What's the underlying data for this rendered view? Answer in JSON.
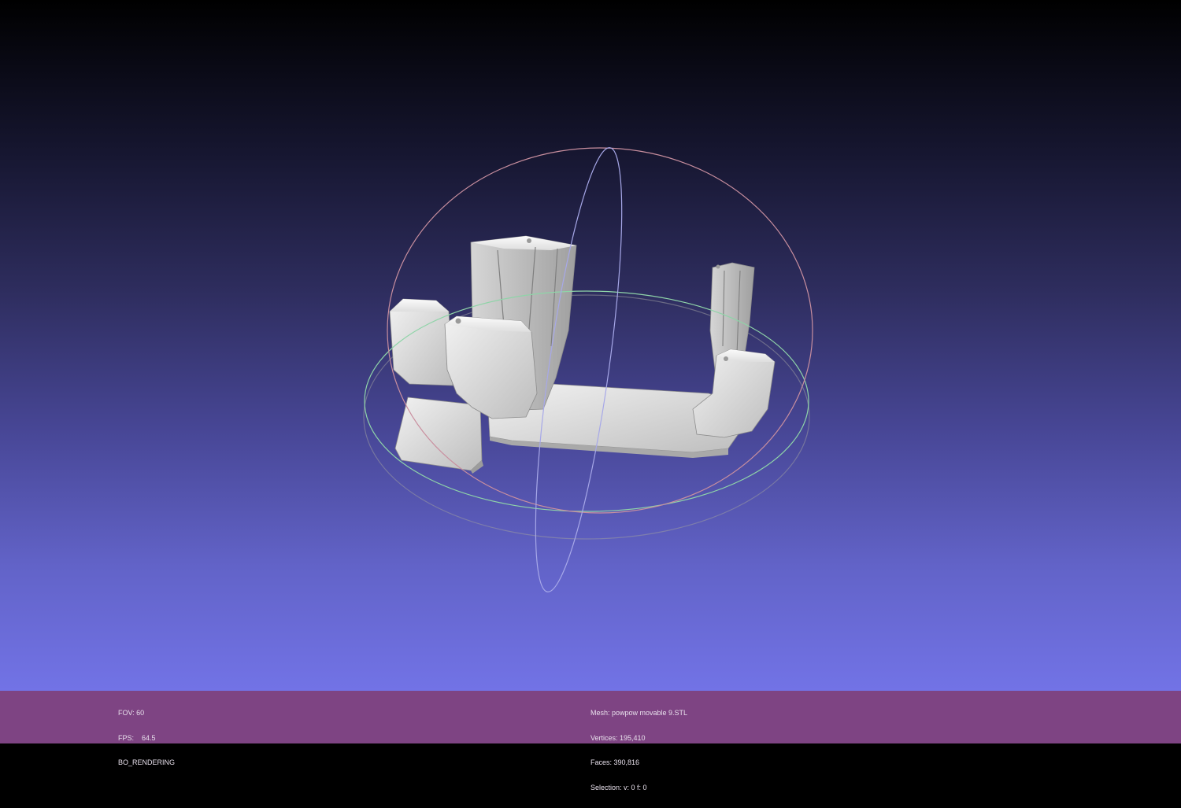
{
  "window": {
    "background_top": "#000000",
    "background_bottom": "#7273e6",
    "status_bar_color": "#7e4483"
  },
  "viewport": {
    "object": "3d-mesh-model",
    "trackball": {
      "ring_colors": [
        "#c98f9f",
        "#8fd4a8",
        "#a7a8e8"
      ]
    }
  },
  "status_left": {
    "fov": "FOV: 60",
    "fps": "FPS:    64.5",
    "mode": "BO_RENDERING"
  },
  "status_right": {
    "mesh": "Mesh: powpow movable 9.STL",
    "vertices": "Vertices: 195,410",
    "faces": "Faces: 390,816",
    "selection": "Selection: v: 0 f: 0"
  }
}
